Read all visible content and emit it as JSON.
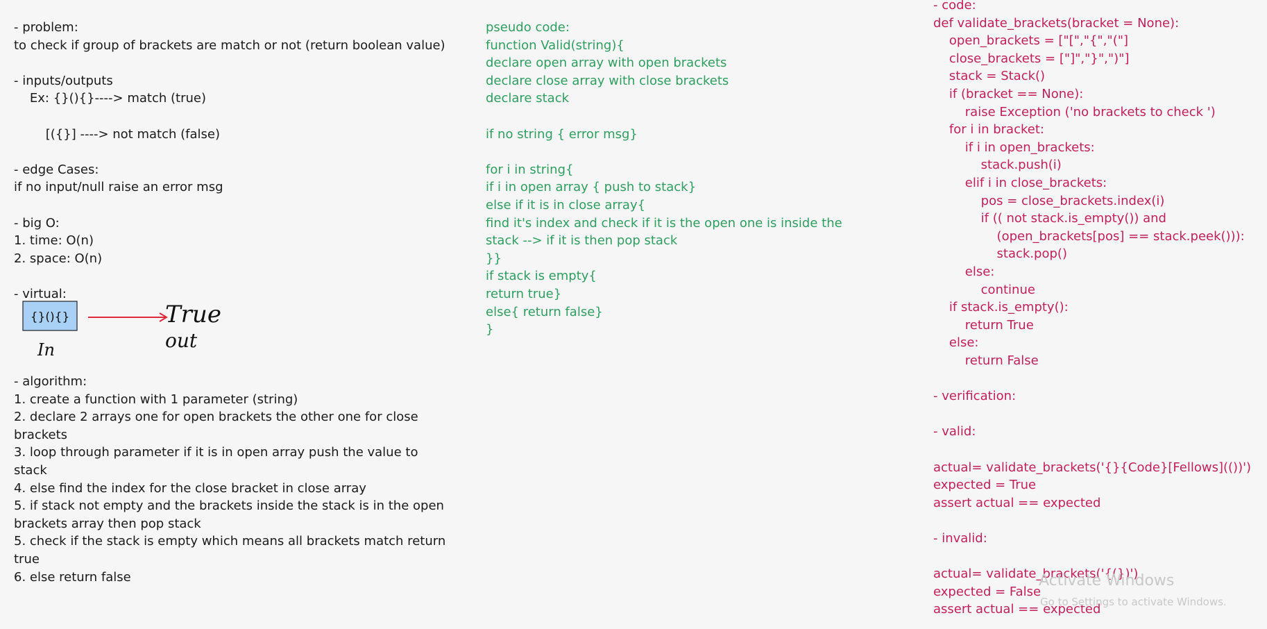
{
  "left_column": [
    "- problem:",
    "to check if group of brackets are match or not (return boolean value)",
    "",
    "- inputs/outputs",
    "    Ex: {}(){}----> match (true)",
    "",
    "        [({}] ----> not match (false)",
    "",
    "- edge Cases:",
    "if no input/null raise an error msg",
    "",
    "- big O:",
    "1. time: O(n)",
    "2. space: O(n)",
    "",
    "- virtual:"
  ],
  "virtual": {
    "box_text": "{}(){}",
    "in_label": "In",
    "true_label": "True",
    "out_label": "out",
    "box_color": "#a9d1f5",
    "arrow_color": "#e0283a"
  },
  "algorithm": [
    "- algorithm:",
    "1. create a function with 1 parameter (string)",
    "2. declare 2 arrays one for open brackets the other one for close",
    "brackets",
    "3. loop through parameter if it is in open array push the value to",
    "stack",
    "4. else find the index for the close bracket in close array",
    "5. if stack not empty and the brackets inside the stack is in the open",
    "brackets array then pop stack",
    "5. check if the stack is empty which means all brackets match return",
    "true",
    "6. else return false"
  ],
  "pseudo_code": [
    "pseudo code:",
    "function Valid(string){",
    "declare open array with open brackets",
    "declare close array with close brackets",
    "declare stack",
    "",
    "if no string { error msg}",
    "",
    "for i in string{",
    "if i in open array { push to stack}",
    "else if it is in close array{",
    "find it's index and check if it is the open one is inside the",
    "stack --> if it is then pop stack",
    "}}",
    "if stack is empty{",
    "return true}",
    "else{ return false}",
    "}"
  ],
  "code_column": [
    "- code:",
    "def validate_brackets(bracket = None):",
    "    open_brackets = [\"[\",\"{\",\"(\"]",
    "    close_brackets = [\"]\",\"}\",\")\"]",
    "    stack = Stack()",
    "    if (bracket == None):",
    "        raise Exception ('no brackets to check ')",
    "    for i in bracket:",
    "        if i in open_brackets:",
    "            stack.push(i)",
    "        elif i in close_brackets:",
    "            pos = close_brackets.index(i)",
    "            if (( not stack.is_empty()) and",
    "                (open_brackets[pos] == stack.peek())):",
    "                stack.pop()",
    "        else:",
    "            continue",
    "    if stack.is_empty():",
    "        return True",
    "    else:",
    "        return False",
    "",
    "- verification:",
    "",
    "- valid:",
    "",
    "actual= validate_brackets('{}{Code}[Fellows](())')",
    "expected = True",
    "assert actual == expected",
    "",
    "- invalid:",
    "",
    "actual= validate_brackets('{(})')",
    "expected = False",
    "assert actual == expected"
  ],
  "watermark": {
    "title": "Activate Windows",
    "subtitle": "Go to Settings to activate Windows."
  },
  "colors": {
    "background": "#f6f6f6",
    "text_black": "#1a1a1a",
    "pseudo_green": "#2e9e5f",
    "code_pink": "#c21f5a"
  }
}
